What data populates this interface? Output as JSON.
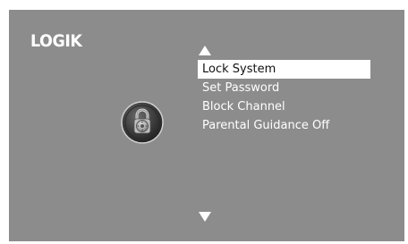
{
  "brand": {
    "logo_text": "LOGIK"
  },
  "icons": {
    "lock": "padlock-dial-icon",
    "scroll_up": "triangle-up-icon",
    "scroll_down": "triangle-down-icon"
  },
  "menu": {
    "items": [
      {
        "label": "Lock System",
        "selected": true
      },
      {
        "label": "Set Password",
        "selected": false
      },
      {
        "label": "Block Channel",
        "selected": false
      },
      {
        "label": "Parental Guidance Off",
        "selected": false
      }
    ]
  },
  "colors": {
    "panel_background": "#8c8c8c",
    "highlight": "#ffffff",
    "text": "#ffffff",
    "selected_text": "#111111"
  }
}
